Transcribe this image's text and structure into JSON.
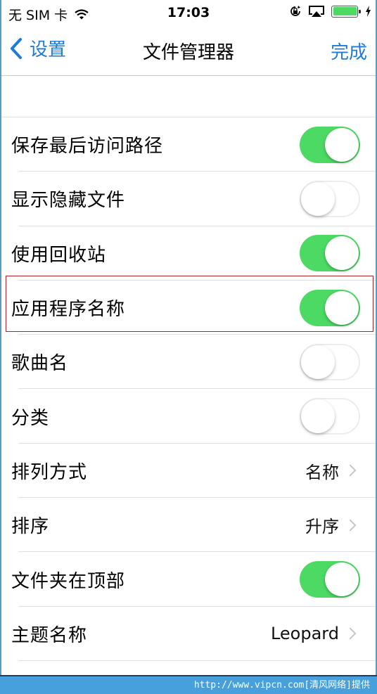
{
  "status_bar": {
    "carrier": "无 SIM 卡",
    "time": "17:03",
    "battery_percent": 100,
    "icons": [
      "wifi-icon",
      "rotation-lock-icon",
      "airplay-icon",
      "battery-icon",
      "charging-icon"
    ]
  },
  "nav": {
    "back_label": "设置",
    "title": "文件管理器",
    "done_label": "完成"
  },
  "rows": [
    {
      "label": "保存最后访问路径",
      "type": "toggle",
      "on": true
    },
    {
      "label": "显示隐藏文件",
      "type": "toggle",
      "on": false
    },
    {
      "label": "使用回收站",
      "type": "toggle",
      "on": true
    },
    {
      "label": "应用程序名称",
      "type": "toggle",
      "on": true,
      "highlighted": true
    },
    {
      "label": "歌曲名",
      "type": "toggle",
      "on": false
    },
    {
      "label": "分类",
      "type": "toggle",
      "on": false
    },
    {
      "label": "排列方式",
      "type": "disclosure",
      "value": "名称"
    },
    {
      "label": "排序",
      "type": "disclosure",
      "value": "升序"
    },
    {
      "label": "文件夹在顶部",
      "type": "toggle",
      "on": true
    },
    {
      "label": "主题名称",
      "type": "disclosure",
      "value": "Leopard"
    }
  ],
  "colors": {
    "accent": "#1e7bd8",
    "toggle_on": "#4cd964",
    "highlight_box": "#b22222",
    "watermark_bg": "#479fdc"
  },
  "watermark": "http://www.vipcn.com[清风网络]提供"
}
